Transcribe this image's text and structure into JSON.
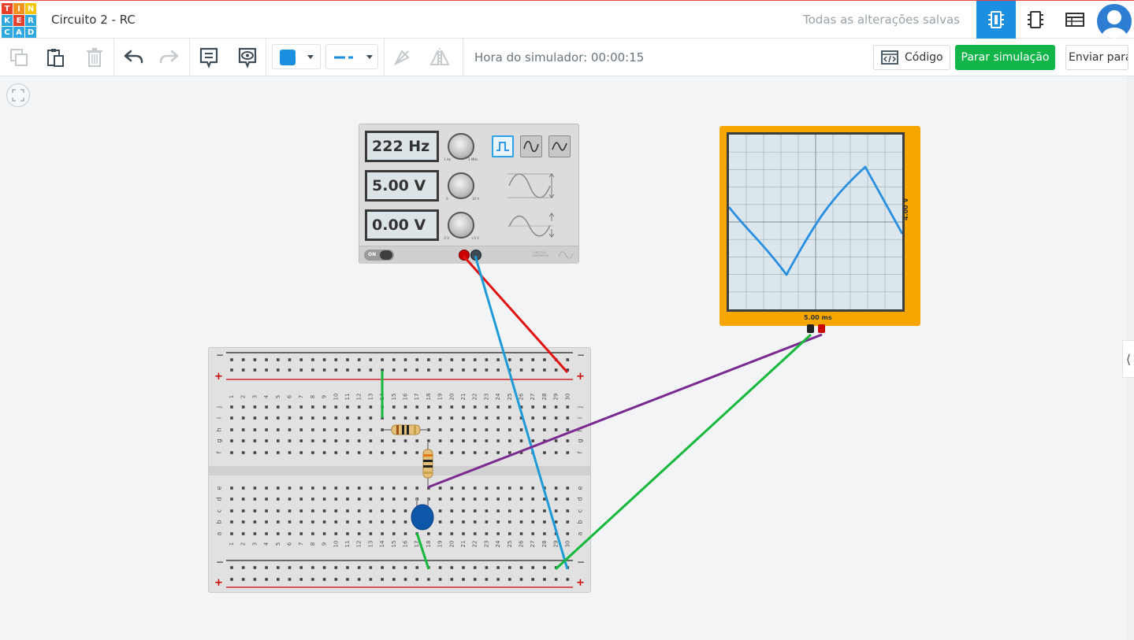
{
  "app": {
    "logo_letters": [
      "T",
      "I",
      "N",
      "K",
      "E",
      "R",
      "C",
      "A",
      "D"
    ],
    "logo_colors": [
      "#e8402a",
      "#f2931f",
      "#f5c400",
      "#2fa8e0",
      "#e8402a",
      "#2fa8e0",
      "#2fa8e0",
      "#2fa8e0",
      "#2fa8e0"
    ],
    "project_title": "Circuito 2 - RC",
    "save_status": "Todas as alterações salvas"
  },
  "toolbar": {
    "sim_time": "Hora do simulador: 00:00:15",
    "code_label": "Código",
    "stop_label": "Parar simulação",
    "send_label": "Enviar para",
    "color_swatch": "#1a8fe0",
    "stop_color": "#12b54a"
  },
  "function_generator": {
    "frequency": "222 Hz",
    "amplitude": "5.00 V",
    "offset": "0.00 V",
    "freq_knob_min": "1 Hz",
    "freq_knob_max": "1 MHz",
    "amp_knob_min": "0",
    "amp_knob_max": "10 V",
    "off_knob_min": "-5 V",
    "off_knob_max": "+5 V",
    "power_label": "ON",
    "brand": "FUNCTION GENERATOR",
    "waveforms": [
      "square",
      "sine",
      "triangle"
    ],
    "selected_waveform": "square"
  },
  "oscilloscope": {
    "time_div": "5.00 ms",
    "volt_div": "4.00 V",
    "trace_color": "#2b8fe0"
  },
  "breadboard": {
    "columns": [
      "1",
      "2",
      "3",
      "4",
      "5",
      "6",
      "7",
      "8",
      "9",
      "10",
      "11",
      "12",
      "13",
      "14",
      "15",
      "16",
      "17",
      "18",
      "19",
      "20",
      "21",
      "22",
      "23",
      "24",
      "25",
      "26",
      "27",
      "28",
      "29",
      "30"
    ],
    "rows_top": [
      "j",
      "i",
      "h",
      "g",
      "f"
    ],
    "rows_bottom": [
      "e",
      "d",
      "c",
      "b",
      "a"
    ],
    "rail_minus": "−",
    "rail_plus": "+"
  },
  "wires": {
    "red": "#e01010",
    "blue": "#1e9bd7",
    "green": "#15b83c",
    "purple": "#7a2a90"
  }
}
